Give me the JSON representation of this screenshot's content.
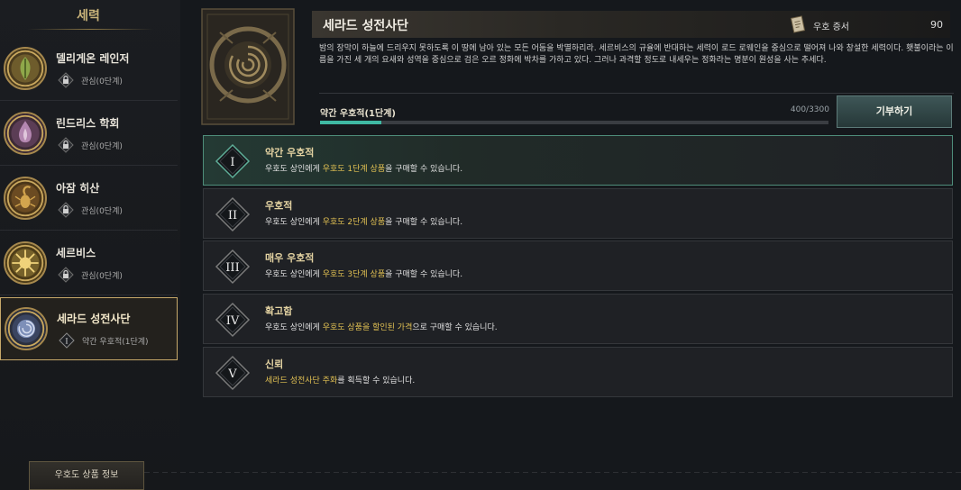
{
  "sidebar": {
    "title": "세력",
    "factions": [
      {
        "name": "델리게온 레인저",
        "status": "관심(0단계)",
        "badge": "lock",
        "emblem": "leaf-emblem"
      },
      {
        "name": "린드리스 학회",
        "status": "관심(0단계)",
        "badge": "lock",
        "emblem": "flame-emblem"
      },
      {
        "name": "아잠 히산",
        "status": "관심(0단계)",
        "badge": "lock",
        "emblem": "scorpion-emblem"
      },
      {
        "name": "세르비스",
        "status": "관심(0단계)",
        "badge": "lock",
        "emblem": "sun-emblem"
      },
      {
        "name": "세라드 성전사단",
        "status": "약간 우호적(1단계)",
        "badge": "I",
        "emblem": "rose-emblem",
        "selected": true
      }
    ],
    "footer_button": "우호도 상품 정보"
  },
  "header": {
    "title": "세라드 성전사단",
    "certificate_label": "우호 증서",
    "certificate_value": "90",
    "description": "밤의 장막이 하늘에 드리우지 못하도록 이 땅에 남아 있는 모든 어둠을 박멸하리라. 세르비스의 규율에 반대하는 세력이 로드 로웨인을 중심으로 떨어져 나와 창설한 세력이다. 횃불이라는 이름을 가진 세 개의 요새와 성역을 중심으로 검은 오르 정화에 박차를 가하고 있다. 그러나 과격할 정도로 내세우는 정화라는 명분이 원성을 사는 추세다."
  },
  "reputation": {
    "label": "약간 우호적(1단계)",
    "value_text": "400/3300",
    "progress": 0.1212,
    "donate_button": "기부하기"
  },
  "tiers": [
    {
      "numeral": "I",
      "name": "약간 우호적",
      "pre": "우호도 상인에게 ",
      "hl": "우호도 1단계 상품",
      "post": "을 구매할 수 있습니다.",
      "active": true
    },
    {
      "numeral": "II",
      "name": "우호적",
      "pre": "우호도 상인에게 ",
      "hl": "우호도 2단계 상품",
      "post": "을 구매할 수 있습니다.",
      "active": false
    },
    {
      "numeral": "III",
      "name": "매우 우호적",
      "pre": "우호도 상인에게 ",
      "hl": "우호도 3단계 상품",
      "post": "을 구매할 수 있습니다.",
      "active": false
    },
    {
      "numeral": "IV",
      "name": "확고함",
      "pre": "우호도 상인에게 ",
      "hl": "우호도 상품을 할인된 가격",
      "post": "으로 구매할 수 있습니다.",
      "active": false
    },
    {
      "numeral": "V",
      "name": "신뢰",
      "pre": "",
      "hl": "세라드 성전사단 주화",
      "post": "를 획득할 수 있습니다.",
      "active": false
    }
  ],
  "colors": {
    "accent_gold": "#c7a96a",
    "highlight_text": "#e2c153",
    "progress_teal": "#3fb8a2",
    "active_border": "#4e8d7a"
  }
}
